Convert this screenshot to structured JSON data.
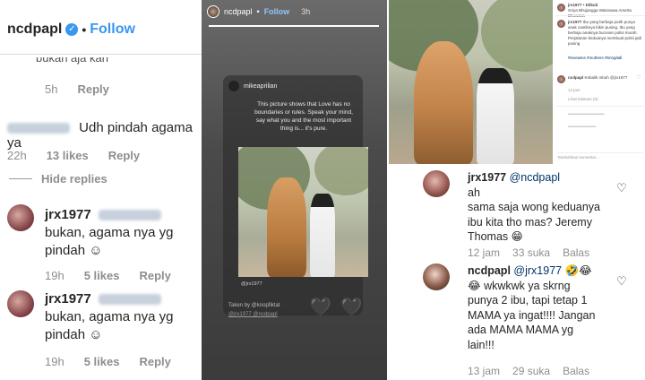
{
  "panel_a": {
    "header": {
      "username": "ncdpapl",
      "dot": "•",
      "follow": "Follow"
    },
    "cut_comment": "bukan aja kan",
    "c0_meta": {
      "time": "5h",
      "reply": "Reply"
    },
    "c1": {
      "text": "Udh pindah agama ya",
      "time": "22h",
      "likes": "13 likes",
      "reply": "Reply"
    },
    "hide_replies": "Hide replies",
    "r1": {
      "user": "jrx1977",
      "text_line1": "bukan, agama nya yg",
      "text_line2": "pindah ☺",
      "time": "19h",
      "likes": "5 likes",
      "reply": "Reply"
    },
    "r2": {
      "user": "jrx1977",
      "text_line1": "bukan, agama nya yg",
      "text_line2": "pindah ☺",
      "time": "19h",
      "likes": "5 likes",
      "reply": "Reply"
    }
  },
  "panel_b": {
    "user": "ncdpapl",
    "follow": "Follow",
    "time": "3h",
    "card_user": "mikeaprilian",
    "quote": "This picture shows that Love has no boundaries or rules. Speak your mind, say what you and the most important thing is... it's pure.",
    "photo_tag": "@jrx1977",
    "taken_by": "Taken by @knopfiktat",
    "mentions": "@jrx1977 @ncdpapl",
    "hearts": "🖤 🖤"
  },
  "panel_c": {
    "side": {
      "author": "jrx1977 • Diikuti",
      "location": "Griya Bhujangga Waisnawa Amerta Bhuwana",
      "caption_user": "jrx1977",
      "caption": "Ibu yang berbaju putih punya anak cantiknya bikin pusing. Ibu yang berbaju anaknya buronan polisi murah. Perjalanan keduanya membuat polisi jadi pusing",
      "hashtags": "#lovewins #mothers #bringitall",
      "reply_user": "ncdpapl",
      "reply_text": "Kebalik mbuh @jrx1977",
      "reply_meta": "14 jam",
      "likes": "Lihat balasan (6)",
      "input_placeholder": "Tambahkan komentar..."
    },
    "comments": [
      {
        "user": "jrx1977",
        "mention": "@ncdpapl",
        "line1": "ah",
        "line2": "sama saja wong keduanya",
        "line3": "ibu kita tho mas? Jeremy",
        "line4": "Thomas 😁",
        "time": "12 jam",
        "likes": "33 suka",
        "reply": "Balas"
      },
      {
        "user": "ncdpapl",
        "mention": "@jrx1977",
        "line1": "🤣😂",
        "line2": "😂 wkwkwk ya skrng",
        "line3": "punya 2 ibu, tapi tetap 1",
        "line4": "MAMA ya ingat!!!! Jangan",
        "line5": "ada MAMA MAMA yg",
        "line6": "lain!!!",
        "time": "13 jam",
        "likes": "29 suka",
        "reply": "Balas"
      }
    ]
  }
}
